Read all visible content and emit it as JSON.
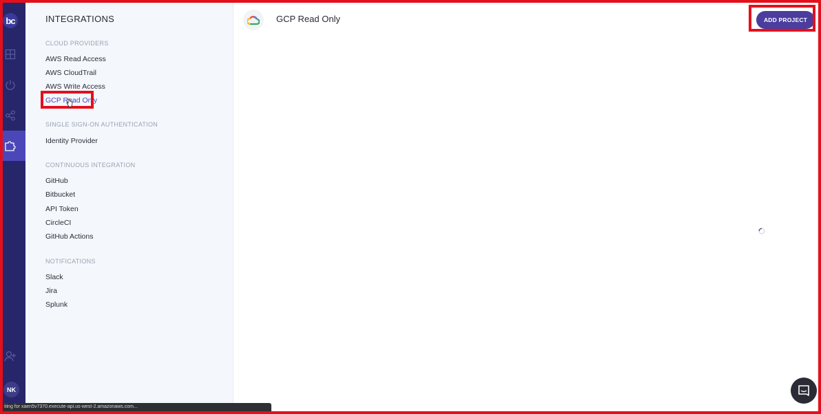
{
  "rail": {
    "logo_text": "bc",
    "avatar_initials": "NK",
    "icons": [
      "dashboard-icon",
      "power-icon",
      "share-icon",
      "integrations-puzzle-icon",
      "add-user-icon"
    ]
  },
  "sidebar": {
    "title": "INTEGRATIONS",
    "sections": [
      {
        "header": "CLOUD PROVIDERS",
        "items": [
          "AWS Read Access",
          "AWS CloudTrail",
          "AWS Write Access",
          "GCP Read Only"
        ]
      },
      {
        "header": "SINGLE SIGN-ON AUTHENTICATION",
        "items": [
          "Identity Provider"
        ]
      },
      {
        "header": "CONTINUOUS INTEGRATION",
        "items": [
          "GitHub",
          "Bitbucket",
          "API Token",
          "CircleCI",
          "GitHub Actions"
        ]
      },
      {
        "header": "NOTIFICATIONS",
        "items": [
          "Slack",
          "Jira",
          "Splunk"
        ]
      }
    ],
    "active_item": "GCP Read Only"
  },
  "main": {
    "title": "GCP Read Only",
    "add_button": "ADD PROJECT"
  },
  "status_bar": {
    "text": "iting for xaen5v7370.execute-api.us-west-2.amazonaws.com..."
  },
  "colors": {
    "rail": "#27266b",
    "accent": "#4a3d9e",
    "highlight": "#e3101c"
  }
}
